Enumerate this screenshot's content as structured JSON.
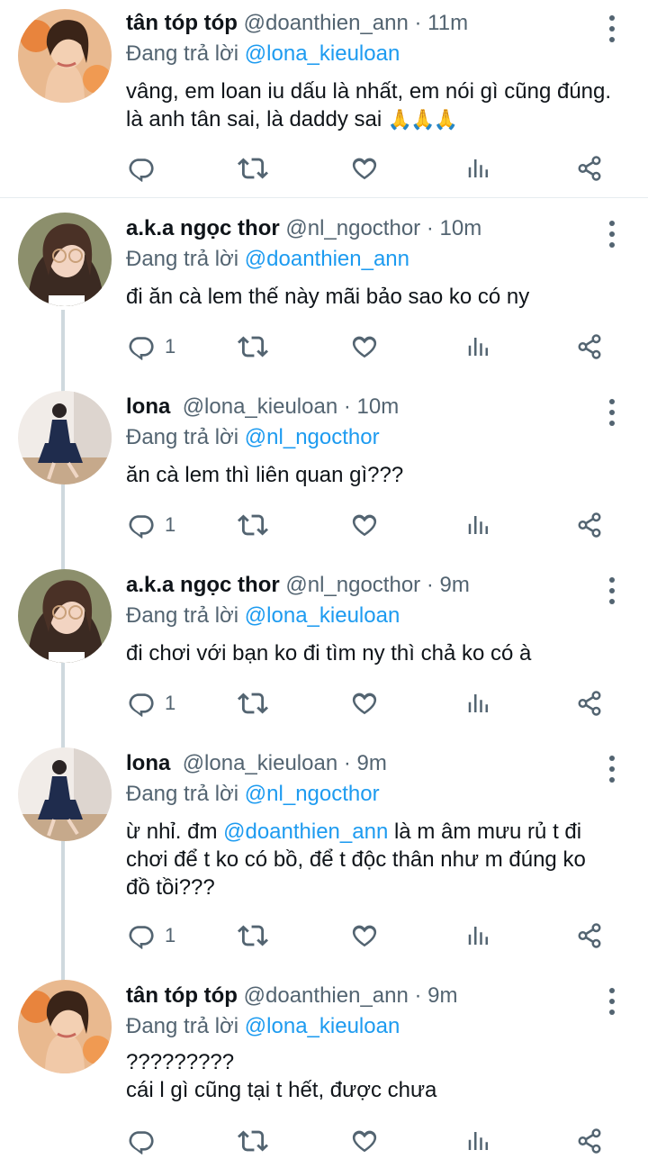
{
  "replying_label": "Đang trả lời",
  "tweets": [
    {
      "name": "tân tóp tóp",
      "handle": "@doanthien_ann",
      "sep": "·",
      "time": "11m",
      "reply_to": "@lona_kieuloan",
      "text": "vâng, em loan iu dấu là nhất, em nói gì cũng đúng. là anh tân sai, là daddy sai",
      "emoji": "🙏🙏🙏",
      "reply_count": ""
    },
    {
      "name": "a.k.a ngọc thor",
      "handle": "@nl_ngocthor",
      "sep": "·",
      "time": "10m",
      "reply_to": "@doanthien_ann",
      "text": "đi ăn cà lem thế này mãi bảo sao ko có ny",
      "reply_count": "1"
    },
    {
      "name": "lona",
      "handle": "@lona_kieuloan",
      "sep": "·",
      "time": "10m",
      "reply_to": "@nl_ngocthor",
      "text": "ăn cà lem thì liên quan gì???",
      "reply_count": "1"
    },
    {
      "name": "a.k.a ngọc thor",
      "handle": "@nl_ngocthor",
      "sep": "·",
      "time": "9m",
      "reply_to": "@lona_kieuloan",
      "text": "đi chơi với bạn ko đi tìm ny thì chả ko có à",
      "reply_count": "1"
    },
    {
      "name": "lona",
      "handle": "@lona_kieuloan",
      "sep": "·",
      "time": "9m",
      "reply_to": "@nl_ngocthor",
      "text_pre": "ừ nhỉ. đm ",
      "text_mention": "@doanthien_ann",
      "text_post": " là m âm mưu rủ t đi chơi để t ko có bồ, để t độc thân như m đúng ko đồ tồi???",
      "reply_count": "1"
    },
    {
      "name": "tân tóp tóp",
      "handle": "@doanthien_ann",
      "sep": "·",
      "time": "9m",
      "reply_to": "@lona_kieuloan",
      "text_line1": "?????????",
      "text_line2": "cái l gì cũng tại t hết, được chưa",
      "reply_count": ""
    }
  ],
  "icons": {
    "reply": "reply-icon",
    "retweet": "retweet-icon",
    "like": "heart-icon",
    "views": "views-icon",
    "share": "share-icon",
    "more": "more-icon"
  },
  "colors": {
    "mention": "#1d9bf0",
    "secondary": "#536471",
    "thread_line": "#cfd9de"
  }
}
